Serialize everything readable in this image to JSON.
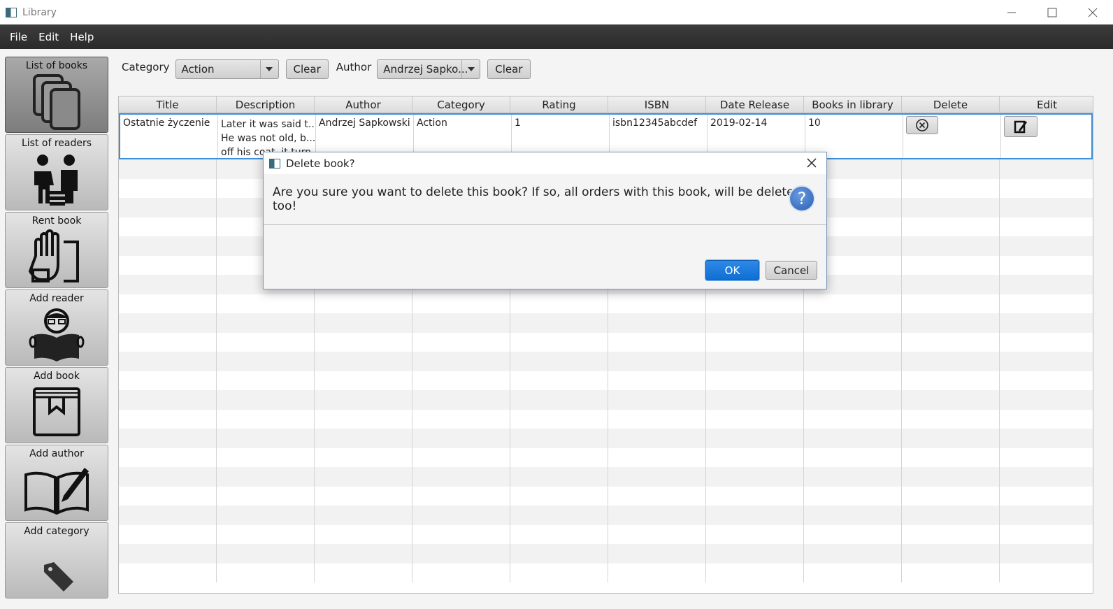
{
  "window": {
    "title": "Library"
  },
  "menu": {
    "file": "File",
    "edit": "Edit",
    "help": "Help"
  },
  "sidebar": {
    "items": [
      {
        "label": "List of books"
      },
      {
        "label": "List of readers"
      },
      {
        "label": "Rent book"
      },
      {
        "label": "Add reader"
      },
      {
        "label": "Add book"
      },
      {
        "label": "Add author"
      },
      {
        "label": "Add category"
      }
    ]
  },
  "filters": {
    "category_label": "Category",
    "category_value": "Action",
    "clear_label": "Clear",
    "author_label": "Author",
    "author_value": "Andrzej Sapko...",
    "clear2_label": "Clear"
  },
  "table": {
    "headers": [
      "Title",
      "Description",
      "Author",
      "Category",
      "Rating",
      "ISBN",
      "Date Release",
      "Books in library",
      "Delete",
      "Edit"
    ],
    "rows": [
      {
        "title": "Ostatnie życzenie",
        "description": [
          "Later it was said t...",
          "He was not old, b...",
          "off his coat, it turn..."
        ],
        "author": "Andrzej Sapkowski",
        "category": "Action",
        "rating": "1",
        "isbn": "isbn12345abcdef",
        "date": "2019-02-14",
        "count": "10"
      }
    ]
  },
  "dialog": {
    "title": "Delete book?",
    "message": "Are you sure you want to delete this book? If so, all orders with this book, will be deleted too!",
    "ok": "OK",
    "cancel": "Cancel",
    "icon": "question-icon"
  }
}
